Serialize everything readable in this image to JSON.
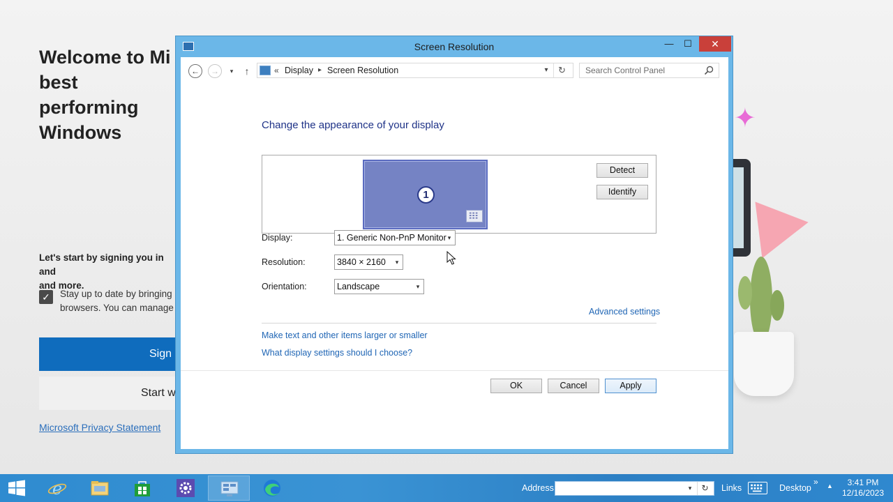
{
  "background_app": {
    "title": "Welcome to Mi\nbest performing\nWindows",
    "lead": "Let's start by signing you in and\nand more.",
    "checkbox_text": "Stay up to date by bringing\nbrowsers. You can manage",
    "sign_in_label": "Sign",
    "start_label": "Start w",
    "privacy_link": "Microsoft Privacy Statement"
  },
  "window": {
    "title": "Screen Resolution",
    "minimize": "—",
    "maximize": "☐",
    "close": "✕"
  },
  "address_bar": {
    "back": "←",
    "forward": "→",
    "recent": "▾",
    "up": "↑",
    "separator": "«",
    "crumb_separator": "▸",
    "crumbs": [
      "Display",
      "Screen Resolution"
    ],
    "dropdown": "▾",
    "refresh": "↻",
    "search_placeholder": "Search Control Panel"
  },
  "content": {
    "heading": "Change the appearance of your display",
    "monitor_number": "1",
    "detect_label": "Detect",
    "identify_label": "Identify",
    "display_label": "Display:",
    "display_value": "1. Generic Non-PnP Monitor",
    "resolution_label": "Resolution:",
    "resolution_value": "3840 × 2160",
    "orientation_label": "Orientation:",
    "orientation_value": "Landscape",
    "select_arrow": "▾",
    "advanced_link": "Advanced settings",
    "text_size_link": "Make text and other items larger or smaller",
    "which_settings_link": "What display settings should I choose?",
    "ok_label": "OK",
    "cancel_label": "Cancel",
    "apply_label": "Apply"
  },
  "taskbar": {
    "address_label": "Address",
    "address_value": "",
    "address_drop": "▾",
    "address_go": "↻",
    "links_label": "Links",
    "desktop_label": "Desktop",
    "chevron": "»",
    "tray_up": "▲",
    "time": "3:41 PM",
    "date": "12/16/2023",
    "accent": "#2f8bd0"
  }
}
